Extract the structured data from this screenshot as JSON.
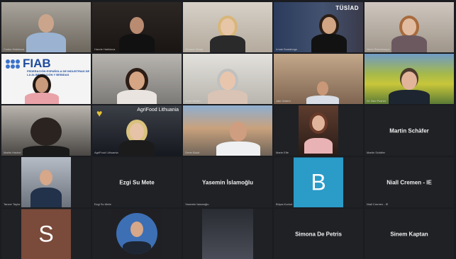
{
  "participants": [
    {
      "id": "p1",
      "tag": "Cosku Hakkiova"
    },
    {
      "id": "p2",
      "tag": "Hande Hakkiova"
    },
    {
      "id": "p3",
      "tag": "Simone Zewyl"
    },
    {
      "id": "p4",
      "tag": "Irmak Bustabogu",
      "overlay": "TÜSİAD"
    },
    {
      "id": "p5",
      "tag": "Nerel Stewekoupe"
    },
    {
      "id": "p6",
      "tag": "",
      "logo": "FIAB",
      "logo_sub": "FEDERACIÓN ESPAÑOLA DE INDUSTRIAS DE LA ALIMENTACIÓN Y BEBIDAS"
    },
    {
      "id": "p7",
      "tag": ""
    },
    {
      "id": "p8",
      "tag": "Anne Kristin"
    },
    {
      "id": "p9",
      "tag": "Jale Ordem"
    },
    {
      "id": "p10",
      "tag": "Dr. Ben Pusher"
    },
    {
      "id": "p11",
      "tag": "Martin Hackel"
    },
    {
      "id": "p12",
      "tag": "AgriFood Lithuania",
      "overlay": "AgriFood Lithuania"
    },
    {
      "id": "p13",
      "tag": "Omer Bulut"
    },
    {
      "id": "p14",
      "tag": "Marie Elfe"
    },
    {
      "id": "p15",
      "name": "Martin Schäfer",
      "tag": "Martin Schäfer"
    },
    {
      "id": "p16",
      "tag": "Tanzer Taylor"
    },
    {
      "id": "p17",
      "name": "Ezgi Su Mete",
      "tag": "Ezgi Su Mete"
    },
    {
      "id": "p18",
      "name": "Yasemin İslamoğlu",
      "tag": "Yasemin İslamoğlu"
    },
    {
      "id": "p19",
      "initial": "B",
      "tag": "Büşra Korkut"
    },
    {
      "id": "p20",
      "name": "Niall Cremen - IE",
      "tag": "Niall Cremen - IE"
    },
    {
      "id": "p21",
      "initial": "S",
      "tag": ""
    },
    {
      "id": "p22",
      "tag": ""
    },
    {
      "id": "p23",
      "tag": ""
    },
    {
      "id": "p24",
      "name": "Simona De Petris",
      "tag": ""
    },
    {
      "id": "p25",
      "name": "Sinem Kaptan",
      "tag": ""
    }
  ],
  "colors": {
    "avatar_b": "#2b9bc8",
    "avatar_s": "#7a4a3a",
    "tile_bg": "#1f2125"
  }
}
